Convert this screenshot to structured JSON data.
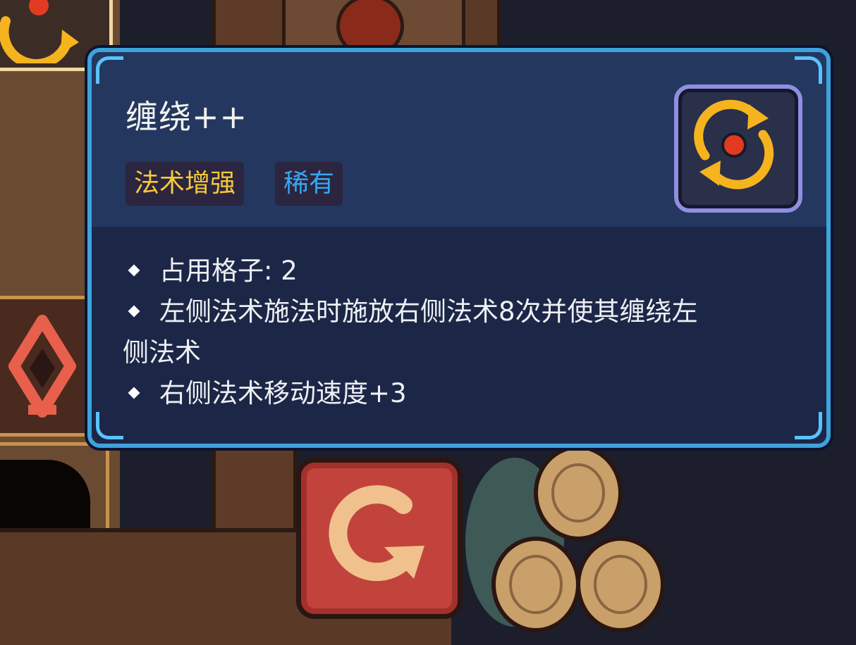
{
  "tooltip": {
    "title": "缠绕++",
    "tags": {
      "type": "法术增强",
      "rarity": "稀有"
    },
    "icon": "swirl-orbit-icon",
    "stats": [
      {
        "text": "占用格子: 2"
      },
      {
        "text": "左侧法术施法时施放右侧法术8次并使其缠绕左",
        "continuation": "侧法术"
      },
      {
        "text": "右侧法术移动速度+3"
      }
    ]
  },
  "colors": {
    "frame": "#3ea3dc",
    "tag_type": "#f5c93a",
    "tag_rarity": "#36a9f0",
    "panel_header": "#24375f",
    "panel_body": "#1c2747",
    "icon_orange": "#f5b41e",
    "icon_red": "#e23b22"
  },
  "background": {
    "card_icons": [
      "rotate-arrow-icon",
      "diamond-arrow-icon",
      "circular-arrow-icon"
    ]
  }
}
